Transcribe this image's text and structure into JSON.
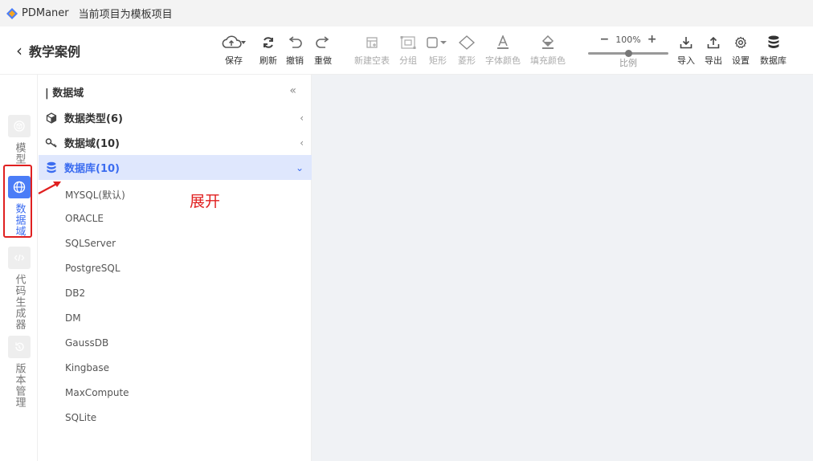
{
  "titlebar": {
    "app_name": "PDManer",
    "project_title": "当前项目为模板项目"
  },
  "header": {
    "back_label": "教学案例"
  },
  "toolbar": {
    "save": "保存",
    "refresh": "刷新",
    "undo": "撤销",
    "redo": "重做",
    "new_table": "新建空表",
    "group": "分组",
    "rect": "矩形",
    "diamond": "菱形",
    "font_color": "字体颜色",
    "fill_color": "填充颜色",
    "zoom_minus": "−",
    "zoom_value": "100%",
    "zoom_plus": "+",
    "zoom_label": "比例",
    "import": "导入",
    "export": "导出",
    "settings": "设置",
    "database": "数据库"
  },
  "leftnav": {
    "model": "模型",
    "domain": "数据域",
    "codegen": "代码生成器",
    "version": "版本管理"
  },
  "panel": {
    "title": "数据域",
    "collapse": "«",
    "groups": [
      {
        "label": "数据类型(6)",
        "arrow": "‹"
      },
      {
        "label": "数据域(10)",
        "arrow": "‹"
      },
      {
        "label": "数据库(10)",
        "arrow": "⌄"
      }
    ],
    "databases": [
      "MYSQL(默认)",
      "ORACLE",
      "SQLServer",
      "PostgreSQL",
      "DB2",
      "DM",
      "GaussDB",
      "Kingbase",
      "MaxCompute",
      "SQLite"
    ]
  },
  "annotation": {
    "text": "展开"
  },
  "colors": {
    "accent": "#4b7df7",
    "highlight": "#e02020",
    "active_row": "#dfe7fd",
    "canvas": "#f0f2f5"
  }
}
